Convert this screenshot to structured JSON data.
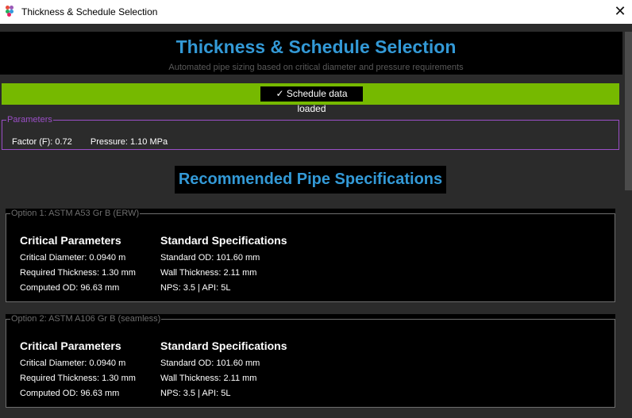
{
  "window": {
    "title": "Thickness & Schedule Selection",
    "close_glyph": "✕"
  },
  "header": {
    "title": "Thickness & Schedule Selection",
    "subtitle": "Automated pipe sizing based on critical diameter and pressure requirements"
  },
  "status": {
    "text": "✓ Schedule data loaded",
    "color": "#76b900"
  },
  "parameters": {
    "legend": "Parameters",
    "factor": "Factor (F): 0.72",
    "pressure": "Pressure: 1.10 MPa"
  },
  "recommended_title": "Recommended Pipe Specifications",
  "options": [
    {
      "legend": "Option 1: ASTM A53 Gr B (ERW)",
      "critical": {
        "heading": "Critical Parameters",
        "diameter": "Critical Diameter: 0.0940 m",
        "thickness": "Required Thickness: 1.30 mm",
        "od": "Computed OD: 96.63 mm"
      },
      "standard": {
        "heading": "Standard Specifications",
        "od": "Standard OD: 101.60 mm",
        "wall": "Wall Thickness: 2.11 mm",
        "nps": "NPS: 3.5 | API: 5L"
      }
    },
    {
      "legend": "Option 2: ASTM A106 Gr B (seamless)",
      "critical": {
        "heading": "Critical Parameters",
        "diameter": "Critical Diameter: 0.0940 m",
        "thickness": "Required Thickness: 1.30 mm",
        "od": "Computed OD: 96.63 mm"
      },
      "standard": {
        "heading": "Standard Specifications",
        "od": "Standard OD: 101.60 mm",
        "wall": "Wall Thickness: 2.11 mm",
        "nps": "NPS: 3.5 | API: 5L"
      }
    }
  ]
}
